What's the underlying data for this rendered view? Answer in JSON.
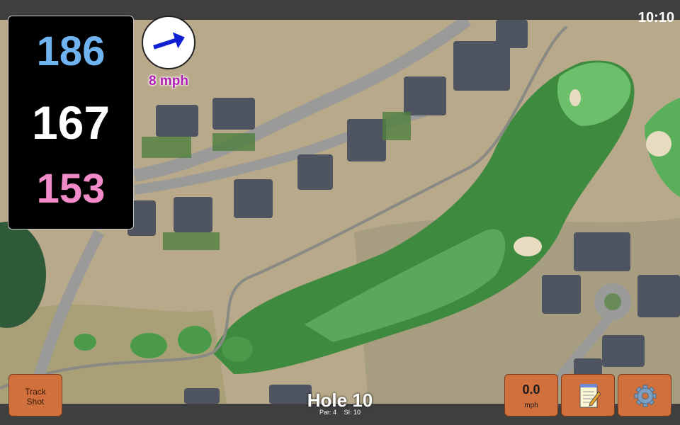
{
  "clock": "10:10",
  "yardages": {
    "back": "186",
    "middle": "167",
    "front": "153"
  },
  "wind": {
    "speed_label": "8 mph",
    "direction_icon": "arrow-icon"
  },
  "buttons": {
    "track_shot_line1": "Track",
    "track_shot_line2": "Shot",
    "wind_value": "0.0",
    "wind_unit": "mph",
    "notes_icon": "notepad-icon",
    "settings_icon": "gear-icon"
  },
  "hole": {
    "title": "Hole 10",
    "par": "Par: 4",
    "si": "SI: 10"
  },
  "colors": {
    "back": "#6fb3f0",
    "middle": "#ffffff",
    "front": "#f08ac8",
    "button": "#d0703c",
    "wind_text": "#b01cb3"
  }
}
